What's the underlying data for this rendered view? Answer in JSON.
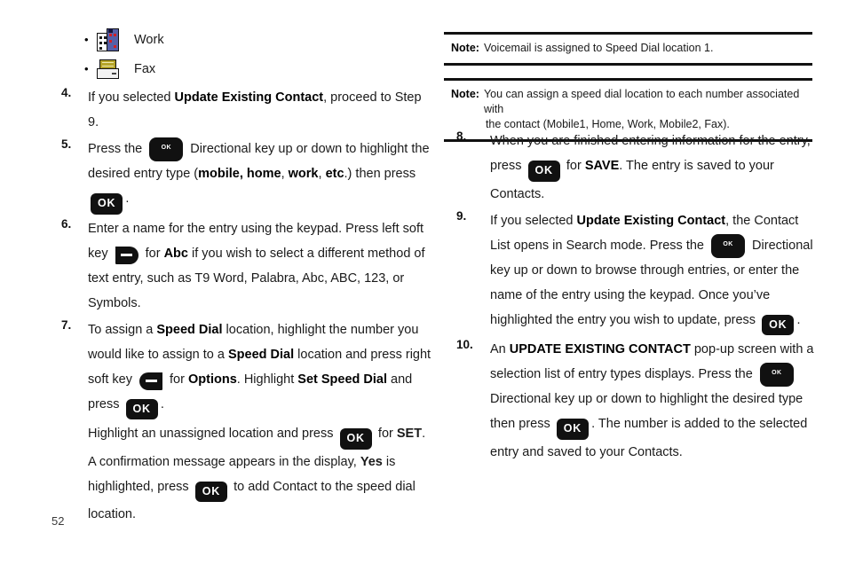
{
  "page": {
    "number": "52"
  },
  "left_column": {
    "bullets": [
      {
        "icon": "work-building-icon",
        "label": "Work"
      },
      {
        "icon": "fax-machine-icon",
        "label": "Fax"
      }
    ],
    "steps": [
      {
        "number": "4.",
        "segments": [
          {
            "type": "text",
            "value": "If you selected "
          },
          {
            "type": "bold",
            "value": "Update Existing Contact"
          },
          {
            "type": "text",
            "value": ", proceed to Step 9."
          }
        ]
      },
      {
        "number": "5.",
        "segments": [
          {
            "type": "text",
            "value": "Press the "
          },
          {
            "type": "key-directional",
            "value": "OK"
          },
          {
            "type": "text",
            "value": " Directional key up or down to highlight the desired entry type ("
          },
          {
            "type": "bold",
            "value": "mobile, home"
          },
          {
            "type": "text",
            "value": ", "
          },
          {
            "type": "bold",
            "value": "work"
          },
          {
            "type": "text",
            "value": ", "
          },
          {
            "type": "bold",
            "value": "etc"
          },
          {
            "type": "text",
            "value": ".) then press "
          },
          {
            "type": "key-ok",
            "value": "OK"
          },
          {
            "type": "text",
            "value": "."
          }
        ]
      },
      {
        "number": "6.",
        "segments": [
          {
            "type": "text",
            "value": "Enter a name for the entry using the keypad. Press left soft key "
          },
          {
            "type": "key-soft-left",
            "value": "left-soft-key"
          },
          {
            "type": "text",
            "value": " for "
          },
          {
            "type": "bold",
            "value": "Abc"
          },
          {
            "type": "text",
            "value": " if you wish to select a different method of text entry, such as T9 Word, Palabra, Abc, ABC, 123, or Symbols."
          }
        ]
      },
      {
        "number": "7.",
        "segments": [
          {
            "type": "text",
            "value": "To assign a "
          },
          {
            "type": "bold",
            "value": "Speed Dial"
          },
          {
            "type": "text",
            "value": " location, highlight the number you would like to assign to a "
          },
          {
            "type": "bold",
            "value": "Speed Dial"
          },
          {
            "type": "text",
            "value": " location and press right soft key "
          },
          {
            "type": "key-soft-right",
            "value": "right-soft-key"
          },
          {
            "type": "text",
            "value": " for "
          },
          {
            "type": "bold",
            "value": "Options"
          },
          {
            "type": "text",
            "value": ". Highlight "
          },
          {
            "type": "bold",
            "value": "Set Speed Dial"
          },
          {
            "type": "text",
            "value": " and press "
          },
          {
            "type": "key-ok",
            "value": "OK"
          },
          {
            "type": "text",
            "value": "."
          }
        ]
      }
    ],
    "sub_paragraph": {
      "segments": [
        {
          "type": "text",
          "value": "Highlight an unassigned location and press "
        },
        {
          "type": "key-ok",
          "value": "OK"
        },
        {
          "type": "text",
          "value": " for "
        },
        {
          "type": "bold",
          "value": "SET"
        },
        {
          "type": "text",
          "value": ". A confirmation message appears in the display, "
        },
        {
          "type": "bold",
          "value": "Yes"
        },
        {
          "type": "text",
          "value": " is highlighted, press "
        },
        {
          "type": "key-ok",
          "value": "OK"
        },
        {
          "type": "text",
          "value": " to add Contact to the speed dial location."
        }
      ]
    }
  },
  "right_column": {
    "notes": [
      {
        "label": "Note:",
        "text": "Voicemail is assigned to Speed Dial location 1.",
        "text2": ""
      },
      {
        "label": "Note:",
        "text": "You can assign a speed dial location to each number associated with",
        "text2": "the contact (Mobile1, Home, Work, Mobile2, Fax)."
      }
    ],
    "steps": [
      {
        "number": "8.",
        "segments": [
          {
            "type": "text",
            "value": "When you are finished entering information for the entry, press "
          },
          {
            "type": "key-ok",
            "value": "OK"
          },
          {
            "type": "text",
            "value": " for "
          },
          {
            "type": "bold",
            "value": "SAVE"
          },
          {
            "type": "text",
            "value": ". The entry is saved to your Contacts."
          }
        ]
      },
      {
        "number": "9.",
        "segments": [
          {
            "type": "text",
            "value": "If you selected "
          },
          {
            "type": "bold",
            "value": "Update Existing Contact"
          },
          {
            "type": "text",
            "value": ", the Contact List opens in Search mode. Press the "
          },
          {
            "type": "key-directional",
            "value": "OK"
          },
          {
            "type": "text",
            "value": " Directional key up or down to browse through entries, or enter the name of the entry using the keypad. Once you’ve highlighted the entry you wish to update, press "
          },
          {
            "type": "key-ok",
            "value": "OK"
          },
          {
            "type": "text",
            "value": "."
          }
        ]
      },
      {
        "number": "10.",
        "segments": [
          {
            "type": "text",
            "value": "An "
          },
          {
            "type": "bold",
            "value": "UPDATE EXISTING CONTACT"
          },
          {
            "type": "text",
            "value": " pop-up screen with a selection list of entry types displays. Press the "
          },
          {
            "type": "key-directional",
            "value": "OK"
          },
          {
            "type": "text",
            "value": " Directional key up or down to highlight the desired type then press "
          },
          {
            "type": "key-ok",
            "value": "OK"
          },
          {
            "type": "text",
            "value": ". The number is added to the selected entry and saved to your Contacts."
          }
        ]
      }
    ]
  }
}
